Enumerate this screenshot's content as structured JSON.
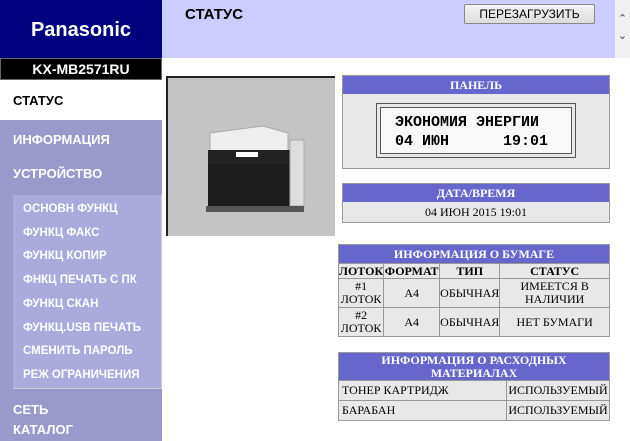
{
  "brand": "Panasonic",
  "model": "KX-MB2571RU",
  "sidebar": {
    "status": "СТАТУС",
    "info": "ИНФОРМАЦИЯ",
    "device": "УСТРОЙСТВО",
    "sub": [
      "ОСНОВН ФУНКЦ",
      "ФУНКЦ ФАКС",
      "ФУНКЦ КОПИР",
      "ФНКЦ ПЕЧАТЬ С ПК",
      "ФУНКЦ СКАН",
      "ФУНКЦ.USB ПЕЧАТЬ",
      "СМЕНИТЬ ПАРОЛЬ",
      "РЕЖ ОГРАНИЧЕНИЯ"
    ],
    "network": "СЕТЬ",
    "catalog": "КАТАЛОГ"
  },
  "header": {
    "title": "СТАТУС",
    "reload": "ПЕРЕЗАГРУЗИТЬ"
  },
  "panel": {
    "title": "ПАНЕЛЬ",
    "line1": "ЭКОНОМИЯ ЭНЕРГИИ",
    "line2": "04 ИЮН      19:01"
  },
  "datetime": {
    "title": "ДАТА/ВРЕМЯ",
    "value": "04 ИЮН 2015 19:01"
  },
  "paper": {
    "title": "ИНФОРМАЦИЯ О БУМАГЕ",
    "headers": [
      "ЛОТОК",
      "ФОРМАТ",
      "ТИП",
      "СТАТУС"
    ],
    "rows": [
      [
        "#1 ЛОТОК",
        "A4",
        "ОБЫЧНАЯ",
        "ИМЕЕТСЯ В НАЛИЧИИ"
      ],
      [
        "#2 ЛОТОК",
        "A4",
        "ОБЫЧНАЯ",
        "НЕТ БУМАГИ"
      ]
    ]
  },
  "consumables": {
    "title": "ИНФОРМАЦИЯ О РАСХОДНЫХ МАТЕРИАЛАХ",
    "rows": [
      [
        "ТОНЕР КАРТРИДЖ",
        "ИСПОЛЬЗУЕМЫЙ"
      ],
      [
        "БАРАБАН",
        "ИСПОЛЬЗУЕМЫЙ"
      ]
    ]
  }
}
